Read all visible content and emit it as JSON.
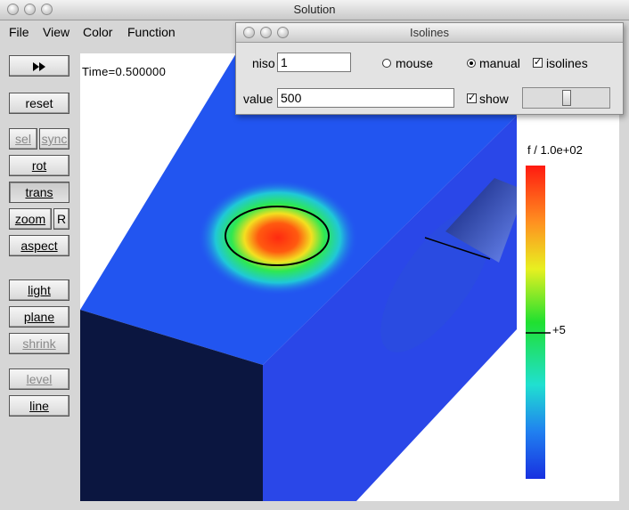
{
  "window": {
    "title": "Solution"
  },
  "menubar": {
    "items": [
      "File",
      "View",
      "Color",
      "Function"
    ]
  },
  "sidebar": {
    "play_icon": "fast-forward-icon",
    "buttons": [
      {
        "key": "reset",
        "label": "reset",
        "enabled": true
      },
      {
        "key": "sel",
        "label": "sel",
        "enabled": false
      },
      {
        "key": "sync",
        "label": "sync",
        "enabled": false
      },
      {
        "key": "rot",
        "label": "rot",
        "enabled": true
      },
      {
        "key": "trans",
        "label": "trans",
        "enabled": true,
        "pressed": true
      },
      {
        "key": "zoom",
        "label": "zoom",
        "enabled": true
      },
      {
        "key": "R",
        "label": "R",
        "enabled": true
      },
      {
        "key": "aspect",
        "label": "aspect",
        "enabled": true
      },
      {
        "key": "light",
        "label": "light",
        "enabled": true
      },
      {
        "key": "plane",
        "label": "plane",
        "enabled": true
      },
      {
        "key": "shrink",
        "label": "shrink",
        "enabled": false
      },
      {
        "key": "level",
        "label": "level",
        "enabled": false
      },
      {
        "key": "line",
        "label": "line",
        "enabled": true
      }
    ]
  },
  "canvas": {
    "time_label": "Time=0.500000",
    "colorbar_title": "f / 1.0e+02",
    "colorbar_marker_label": "+5",
    "colors": {
      "top_face": "#2255f0",
      "side_face": "#2a47e8",
      "front_face": "#0b1640",
      "hot": "#ff2a10",
      "isoline": "#000000"
    }
  },
  "isolines_panel": {
    "title": "Isolines",
    "niso_label": "niso",
    "niso_value": "1",
    "mouse_label": "mouse",
    "mouse_selected": false,
    "manual_label": "manual",
    "manual_selected": true,
    "isolines_label": "isolines",
    "isolines_checked": true,
    "value_label": "value",
    "value_value": "500",
    "show_label": "show",
    "show_checked": true,
    "slider_level": 0.5
  }
}
